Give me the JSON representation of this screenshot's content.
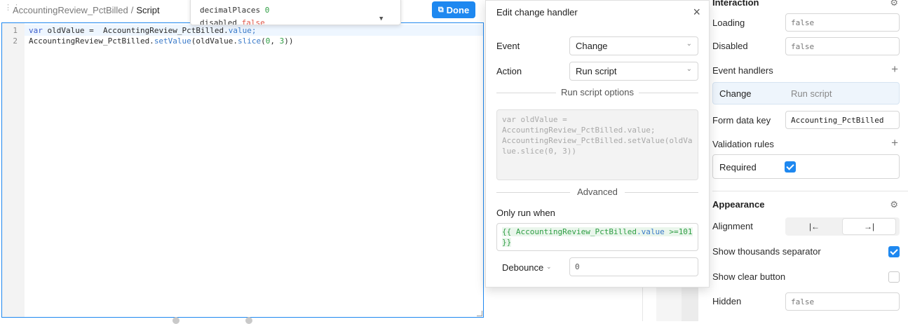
{
  "editor": {
    "breadcrumb_component": "AccountingReview_PctBilled",
    "breadcrumb_sep": "/",
    "breadcrumb_current": "Script",
    "done_label": "Done",
    "line_numbers": [
      "1",
      "2"
    ],
    "line1": {
      "kw": "var",
      "ident": " oldValue =  AccountingReview_PctBilled.",
      "prop": "value",
      "end": ";"
    },
    "line2": {
      "ident": "AccountingReview_PctBilled.",
      "fn": "setValue",
      "a": "(oldValue.",
      "fn2": "slice",
      "b": "(",
      "n1": "0",
      "c": ", ",
      "n2": "3",
      "d": "))"
    }
  },
  "autocomplete": {
    "row1_key": "decimalPlaces ",
    "row1_val": "0",
    "row2_key": "disabled ",
    "row2_val": "false"
  },
  "modal": {
    "title": "Edit change handler",
    "event_label": "Event",
    "event_value": "Change",
    "action_label": "Action",
    "action_value": "Run script",
    "run_script_options": "Run script options",
    "script_text": "var oldValue =\nAccountingReview_PctBilled.value;\nAccountingReview_PctBilled.setValue(oldValue.slice(0, 3))",
    "advanced": "Advanced",
    "only_run_when_label": "Only run when",
    "only_run_when_open": "{{ AccountingReview_PctBilled",
    "only_run_when_prop": ".value",
    "only_run_when_op": " >=",
    "only_run_when_num": "101",
    "only_run_when_close": "}}",
    "debounce_label": "Debounce",
    "debounce_value": "0"
  },
  "inspector": {
    "interaction_title": "Interaction",
    "loading_label": "Loading",
    "loading_value": "false",
    "disabled_label": "Disabled",
    "disabled_value": "false",
    "event_handlers_label": "Event handlers",
    "handler_event": "Change",
    "handler_action": "Run script",
    "form_data_key_label": "Form data key",
    "form_data_key_value": "Accounting_PctBilled",
    "validation_rules_label": "Validation rules",
    "required_label": "Required",
    "required_checked": true,
    "appearance_title": "Appearance",
    "alignment_label": "Alignment",
    "align_left_glyph": "|←",
    "align_right_glyph": "→|",
    "align_selected": "right",
    "show_thousands_label": "Show thousands separator",
    "show_thousands_checked": true,
    "show_clear_label": "Show clear button",
    "show_clear_checked": false,
    "hidden_label": "Hidden",
    "hidden_value": "false"
  },
  "colors": {
    "accent": "#1e88f0",
    "code_number": "#2f9e44",
    "code_bool": "#e0594b"
  },
  "icons": [
    "drag-handle-icon",
    "done-icon",
    "close-icon",
    "chevron-down-icon",
    "plus-icon",
    "sliders-icon",
    "checkmark-icon"
  ]
}
